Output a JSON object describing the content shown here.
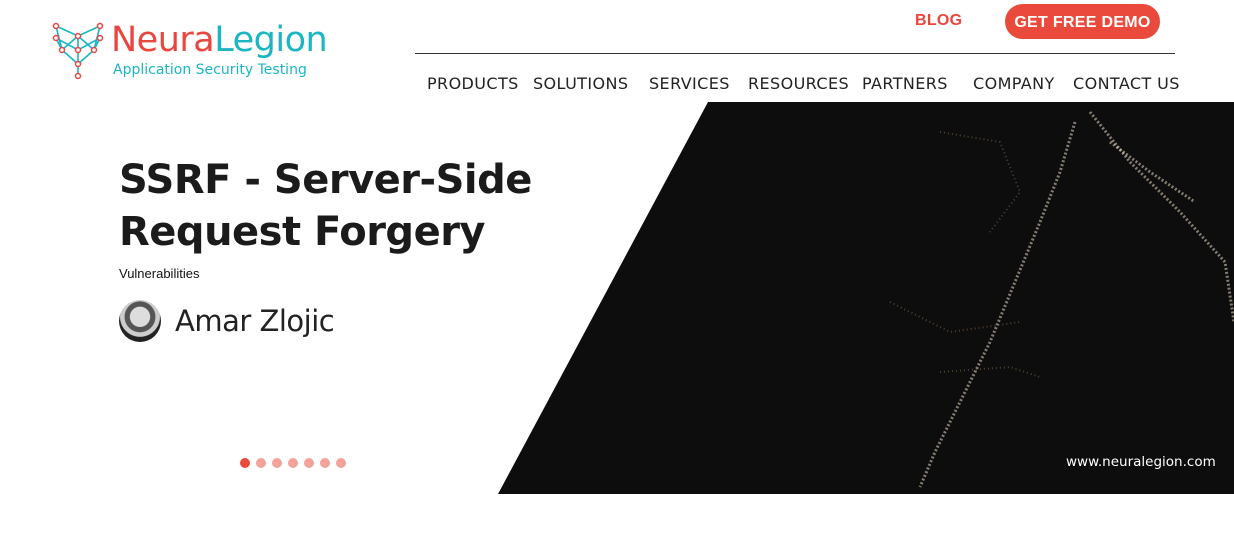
{
  "logo": {
    "name_part1": "Neura",
    "name_part2": "Legion",
    "tagline": "Application Security Testing"
  },
  "header": {
    "blog_label": "BLOG",
    "cta_label": "GET FREE DEMO",
    "nav": [
      "PRODUCTS",
      "SOLUTIONS",
      "SERVICES",
      "RESOURCES",
      "PARTNERS",
      "COMPANY",
      "CONTACT US"
    ]
  },
  "hero": {
    "title": "SSRF - Server-Side Request Forgery",
    "category": "Vulnerabilities",
    "author": "Amar Zlojic",
    "site_url": "www.neuralegion.com",
    "slide_count": 7,
    "active_slide": 1
  },
  "colors": {
    "brand_red": "#ea4a3c",
    "brand_teal": "#1bb5c4",
    "hero_dark": "#0d0d0d"
  }
}
